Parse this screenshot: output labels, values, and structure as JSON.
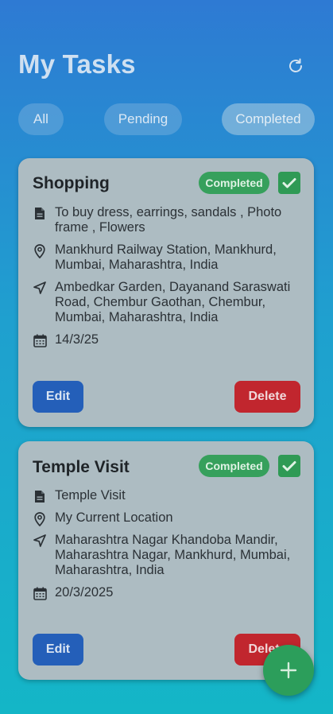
{
  "header": {
    "title": "My Tasks",
    "refresh_icon": "refresh-icon"
  },
  "filters": [
    {
      "label": "All",
      "active": false
    },
    {
      "label": "Pending",
      "active": false
    },
    {
      "label": "Completed",
      "active": true
    }
  ],
  "tasks": [
    {
      "title": "Shopping",
      "status": "Completed",
      "checked": true,
      "description": "To buy dress, earrings, sandals , Photo frame , Flowers",
      "from": "Mankhurd Railway Station, Mankhurd, Mumbai, Maharashtra, India",
      "to": "Ambedkar Garden, Dayanand Saraswati Road, Chembur Gaothan, Chembur, Mumbai, Maharashtra, India",
      "date": "14/3/25",
      "edit_label": "Edit",
      "delete_label": "Delete"
    },
    {
      "title": "Temple Visit",
      "status": "Completed",
      "checked": true,
      "description": "Temple Visit",
      "from": "My Current Location",
      "to": "Maharashtra Nagar Khandoba Mandir, Maharashtra Nagar, Mankhurd, Mumbai, Maharashtra, India",
      "date": "20/3/2025",
      "edit_label": "Edit",
      "delete_label": "Delete"
    }
  ],
  "fab": {
    "icon": "plus-icon"
  },
  "colors": {
    "accent_blue": "#245fb9",
    "danger_red": "#c1262e",
    "success_green": "#36a05c"
  }
}
